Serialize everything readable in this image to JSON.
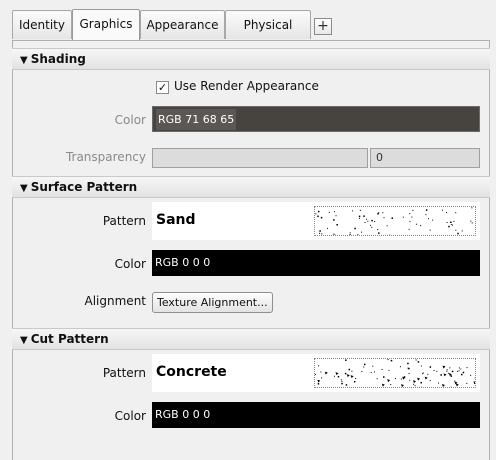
{
  "tabs": [
    {
      "label": "Identity"
    },
    {
      "label": "Graphics"
    },
    {
      "label": "Appearance"
    },
    {
      "label": "Physical"
    }
  ],
  "tab_add_label": "+",
  "shading": {
    "header": "Shading",
    "use_render_appearance_label": "Use Render Appearance",
    "use_render_appearance_checked": true,
    "color_label": "Color",
    "color_value": "RGB 71 68 65",
    "color_swatch": "#47443f",
    "transparency_label": "Transparency",
    "transparency_value": "0"
  },
  "surface_pattern": {
    "header": "Surface Pattern",
    "pattern_label": "Pattern",
    "pattern_value": "Sand",
    "color_label": "Color",
    "color_value": "RGB 0 0 0",
    "color_swatch": "#000000",
    "alignment_label": "Alignment",
    "alignment_button": "Texture Alignment..."
  },
  "cut_pattern": {
    "header": "Cut Pattern",
    "pattern_label": "Pattern",
    "pattern_value": "Concrete",
    "color_label": "Color",
    "color_value": "RGB 0 0 0",
    "color_swatch": "#000000"
  }
}
